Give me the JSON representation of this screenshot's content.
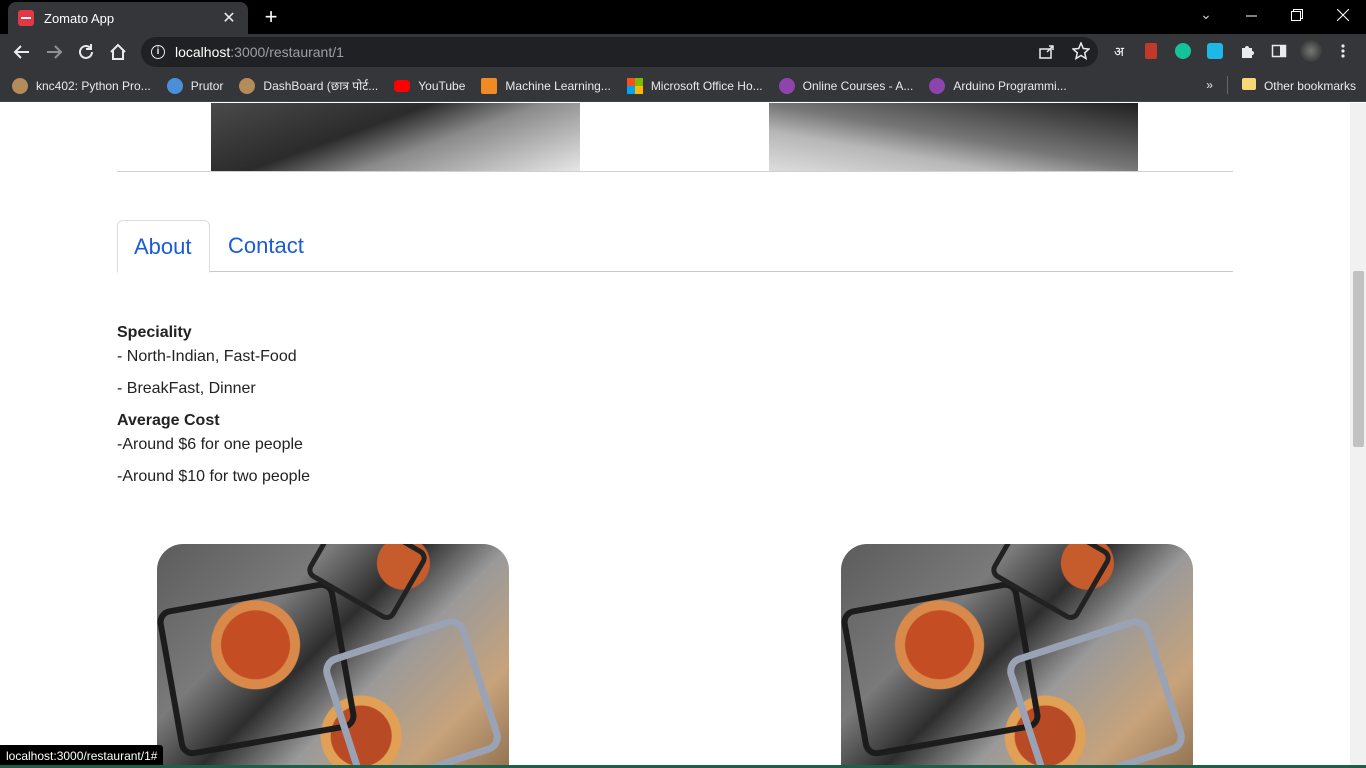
{
  "browser": {
    "tab_title": "Zomato App",
    "url_host": "localhost",
    "url_path": ":3000/restaurant/1",
    "status_url": "localhost:3000/restaurant/1#",
    "bookmarks": [
      {
        "label": "knc402: Python Pro...",
        "color": "#b48c5a"
      },
      {
        "label": "Prutor",
        "color": "#4a90d9"
      },
      {
        "label": "DashBoard (छात्र पोर्ट...",
        "color": "#b48c5a"
      },
      {
        "label": "YouTube",
        "color": "#ff0000"
      },
      {
        "label": "Machine Learning...",
        "color": "#f08a24"
      },
      {
        "label": "Microsoft Office Ho...",
        "color": "#f25022"
      },
      {
        "label": "Online Courses - A...",
        "color": "#8e44ad"
      },
      {
        "label": "Arduino Programmi...",
        "color": "#8e44ad"
      }
    ],
    "other_bookmarks": "Other bookmarks",
    "more_bookmarks": "»",
    "translate_glyph": "अ"
  },
  "page": {
    "tabs": [
      {
        "label": "About",
        "active": true
      },
      {
        "label": "Contact",
        "active": false
      }
    ],
    "about": {
      "speciality_heading": "Speciality",
      "speciality_lines": [
        "- North-Indian, Fast-Food",
        "- BreakFast, Dinner"
      ],
      "cost_heading": "Average Cost",
      "cost_lines": [
        "-Around $6 for one people",
        "-Around $10 for two people"
      ]
    }
  },
  "colors": {
    "link_blue": "#1a5bd6",
    "brand_red": "#e23744"
  }
}
